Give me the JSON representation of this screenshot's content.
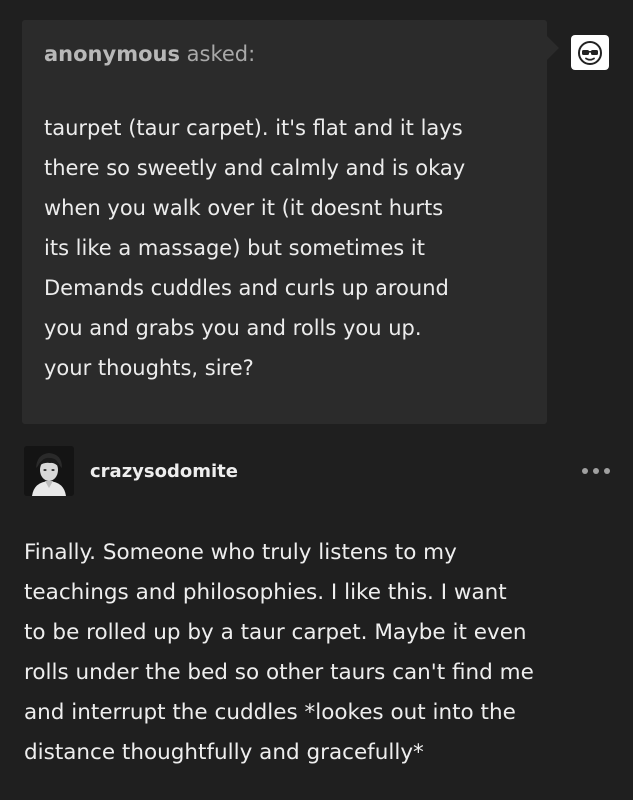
{
  "ask": {
    "asker": "anonymous",
    "verb": " asked:",
    "lines": [
      "taurpet (taur carpet). it's flat and it lays",
      "there so sweetly and calmly and is okay",
      "when you walk over it (it doesnt hurts",
      "its like a massage) but sometimes it",
      "Demands cuddles and curls up around",
      "you and grabs you and rolls you up.",
      "your thoughts, sire?"
    ],
    "avatar_icon": "sunglasses-face-icon"
  },
  "reply": {
    "username": "crazysodomite",
    "avatar_icon": "user-avatar",
    "more_icon": "more-options-icon",
    "lines": [
      "Finally. Someone who truly listens to my",
      "teachings and philosophies. I like this. I want",
      "to be rolled up by a taur carpet. Maybe it even",
      "rolls under the bed so other taurs can't find me",
      "and interrupt the cuddles *lookes out into the",
      "distance thoughtfully and gracefully*"
    ]
  },
  "colors": {
    "background": "#1f1f1f",
    "ask_bubble": "#2b2b2b",
    "text": "#ececec",
    "muted_text": "#a9a9a9"
  }
}
